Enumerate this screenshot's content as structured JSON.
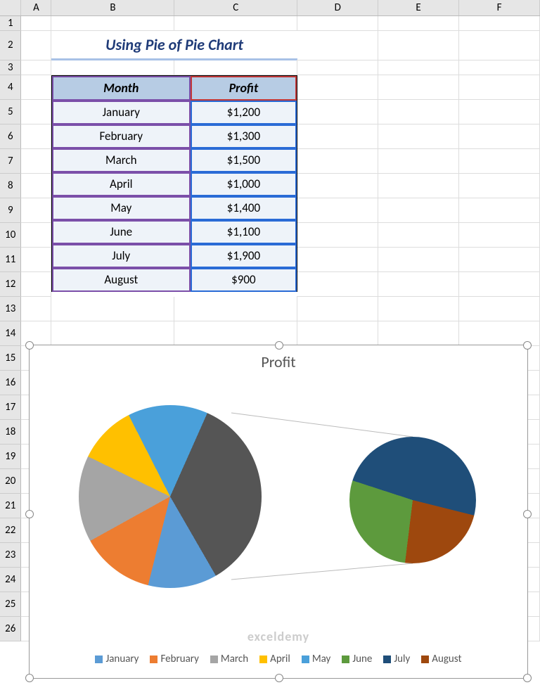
{
  "columns": [
    "A",
    "B",
    "C",
    "D",
    "E",
    "F"
  ],
  "rows_visible": 26,
  "title": "Using Pie of Pie Chart",
  "table": {
    "headers": [
      "Month",
      "Profit"
    ],
    "data": [
      {
        "month": "January",
        "profit": "$1,200"
      },
      {
        "month": "February",
        "profit": "$1,300"
      },
      {
        "month": "March",
        "profit": "$1,500"
      },
      {
        "month": "April",
        "profit": "$1,000"
      },
      {
        "month": "May",
        "profit": "$1,400"
      },
      {
        "month": "June",
        "profit": "$1,100"
      },
      {
        "month": "July",
        "profit": "$1,900"
      },
      {
        "month": "August",
        "profit": "$900"
      }
    ]
  },
  "chart": {
    "title": "Profit",
    "legend": [
      {
        "label": "January",
        "color": "#5b9bd5"
      },
      {
        "label": "February",
        "color": "#ed7d31"
      },
      {
        "label": "March",
        "color": "#a5a5a5"
      },
      {
        "label": "April",
        "color": "#ffc000"
      },
      {
        "label": "May",
        "color": "#4aa0da"
      },
      {
        "label": "June",
        "color": "#5d9a3d"
      },
      {
        "label": "July",
        "color": "#1f4e79"
      },
      {
        "label": "August",
        "color": "#9e480e"
      }
    ]
  },
  "watermark": "exceldemy",
  "chart_data": {
    "type": "pie",
    "subtype": "pie-of-pie",
    "title": "Profit",
    "categories": [
      "January",
      "February",
      "March",
      "April",
      "May",
      "June",
      "July",
      "August"
    ],
    "values": [
      1200,
      1300,
      1500,
      1000,
      1400,
      1100,
      1900,
      900
    ],
    "secondary_categories": [
      "June",
      "July",
      "August"
    ],
    "xlabel": "",
    "ylabel": ""
  }
}
